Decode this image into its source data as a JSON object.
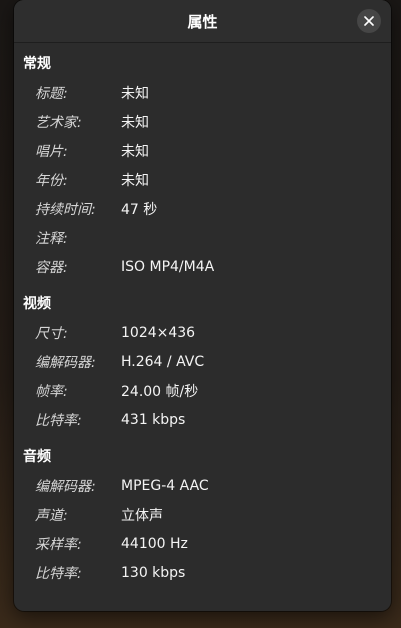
{
  "window": {
    "title": "属性"
  },
  "sections": [
    {
      "title": "常规",
      "rows": [
        {
          "label": "标题:",
          "value": "未知"
        },
        {
          "label": "艺术家:",
          "value": "未知"
        },
        {
          "label": "唱片:",
          "value": "未知"
        },
        {
          "label": "年份:",
          "value": "未知"
        },
        {
          "label": "持续时间:",
          "value": "47 秒"
        },
        {
          "label": "注释:",
          "value": ""
        },
        {
          "label": "容器:",
          "value": "ISO MP4/M4A"
        }
      ]
    },
    {
      "title": "视频",
      "rows": [
        {
          "label": "尺寸:",
          "value": "1024×436"
        },
        {
          "label": "编解码器:",
          "value": "H.264 / AVC"
        },
        {
          "label": "帧率:",
          "value": "24.00 帧/秒"
        },
        {
          "label": "比特率:",
          "value": "431 kbps"
        }
      ]
    },
    {
      "title": "音频",
      "rows": [
        {
          "label": "编解码器:",
          "value": "MPEG-4 AAC"
        },
        {
          "label": "声道:",
          "value": "立体声"
        },
        {
          "label": "采样率:",
          "value": "44100 Hz"
        },
        {
          "label": "比特率:",
          "value": "130 kbps"
        }
      ]
    }
  ],
  "icons": {
    "close": "close-icon"
  },
  "colors": {
    "window_bg": "#2c2c2c",
    "header_bg": "#2e2e2e",
    "close_button_bg": "#464646",
    "label_text": "#d6d6d6",
    "value_text": "#f4f4f4"
  }
}
